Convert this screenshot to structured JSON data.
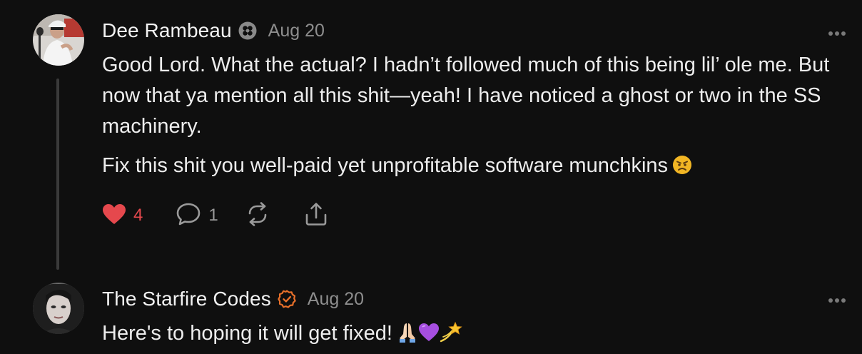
{
  "comments": [
    {
      "author": "Dee Rambeau",
      "badge_icon": "clover-badge-icon",
      "date": "Aug 20",
      "paragraphs": [
        "Good Lord. What the actual? I hadn’t followed much of this being lil’ ole me. But now that ya mention all this shit—yeah! I have noticed a ghost or two in the SS machinery.",
        "Fix this shit you well-paid yet unprofitable software munchkins"
      ],
      "likes": "4",
      "replies": "1",
      "like_color": "#e5484d"
    },
    {
      "author": "The Starfire Codes",
      "badge_icon": "verified-check-icon",
      "badge_color": "#e8702a",
      "date": "Aug 20",
      "text": "Here's to hoping it will get fixed!"
    }
  ],
  "icons": [
    "heart-icon",
    "comment-icon",
    "restack-icon",
    "share-icon",
    "more-icon",
    "angry-face-emoji",
    "praying-hands-emoji",
    "purple-heart-emoji",
    "dizzy-star-emoji"
  ]
}
